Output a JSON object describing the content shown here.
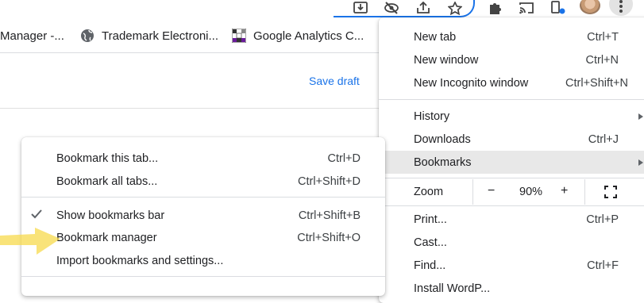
{
  "bookmarks_bar": {
    "items": [
      {
        "label": "Manager -..."
      },
      {
        "label": "Trademark Electroni..."
      },
      {
        "label": "Google Analytics C..."
      }
    ]
  },
  "page": {
    "save_draft": "Save draft"
  },
  "main_menu": {
    "items": [
      {
        "label": "New tab",
        "shortcut": "Ctrl+T"
      },
      {
        "label": "New window",
        "shortcut": "Ctrl+N"
      },
      {
        "label": "New Incognito window",
        "shortcut": "Ctrl+Shift+N"
      },
      {
        "label": "History",
        "shortcut": ""
      },
      {
        "label": "Downloads",
        "shortcut": "Ctrl+J"
      },
      {
        "label": "Bookmarks",
        "shortcut": ""
      },
      {
        "label": "Print...",
        "shortcut": "Ctrl+P"
      },
      {
        "label": "Cast...",
        "shortcut": ""
      },
      {
        "label": "Find...",
        "shortcut": "Ctrl+F"
      },
      {
        "label": "Install WordP...",
        "shortcut": ""
      }
    ],
    "zoom": {
      "label": "Zoom",
      "minus": "−",
      "value": "90%",
      "plus": "+"
    }
  },
  "bookmarks_submenu": {
    "items": [
      {
        "label": "Bookmark this tab...",
        "shortcut": "Ctrl+D"
      },
      {
        "label": "Bookmark all tabs...",
        "shortcut": "Ctrl+Shift+D"
      },
      {
        "label": "Show bookmarks bar",
        "shortcut": "Ctrl+Shift+B",
        "checked": true
      },
      {
        "label": "Bookmark manager",
        "shortcut": "Ctrl+Shift+O"
      },
      {
        "label": "Import bookmarks and settings...",
        "shortcut": ""
      }
    ]
  },
  "colors": {
    "accent": "#1a73e8",
    "highlight": "#e8e8e8",
    "annotation_arrow": "#f7d94c"
  },
  "icons": [
    "download-icon",
    "eye-off-icon",
    "share-icon",
    "star-icon",
    "puzzle-icon",
    "cast-icon",
    "device-icon",
    "avatar",
    "kebab-menu-icon",
    "globe-icon",
    "grid-favicon-icon",
    "check-icon",
    "fullscreen-icon"
  ]
}
